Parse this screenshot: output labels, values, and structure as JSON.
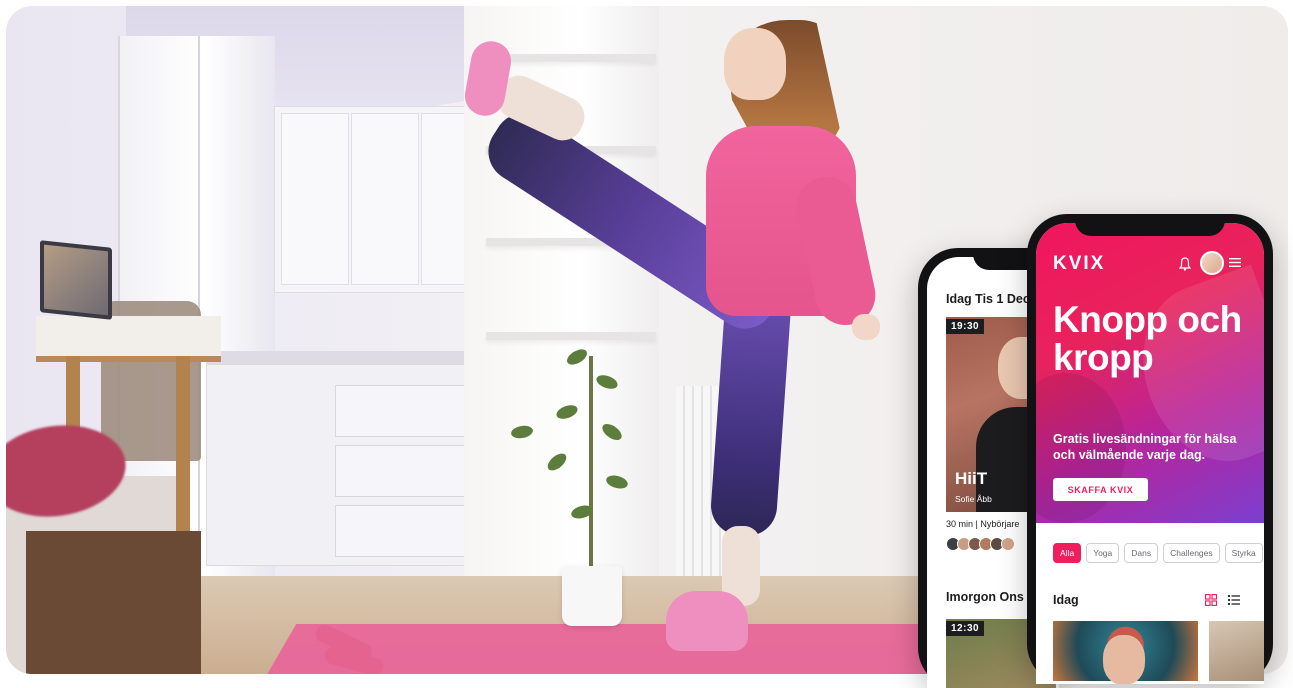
{
  "back_phone": {
    "day1": "Idag Tis 1 Dec",
    "card_time": "19:30",
    "card_title": "HiiT",
    "card_instructor": "Sofie Åbb",
    "card_meta": "30 min | Nybörjare",
    "day2": "Imorgon Ons 2",
    "card2_time": "12:30"
  },
  "front_phone": {
    "logo": "KVIX",
    "headline": "Knopp och kropp",
    "tagline": "Gratis livesändningar för hälsa och välmående varje dag.",
    "cta_label": "SKAFFA KVIX",
    "chips": [
      "Alla",
      "Yoga",
      "Dans",
      "Challenges",
      "Styrka"
    ],
    "active_chip_index": 0,
    "section_title": "Idag"
  },
  "colors": {
    "brand_pink": "#ef1f5d",
    "hero_gradient_end": "#7c3ed0",
    "mat_pink": "#e8679a"
  },
  "icons": [
    "bell-icon",
    "avatar",
    "menu-icon",
    "grid-view-icon",
    "list-view-icon"
  ]
}
